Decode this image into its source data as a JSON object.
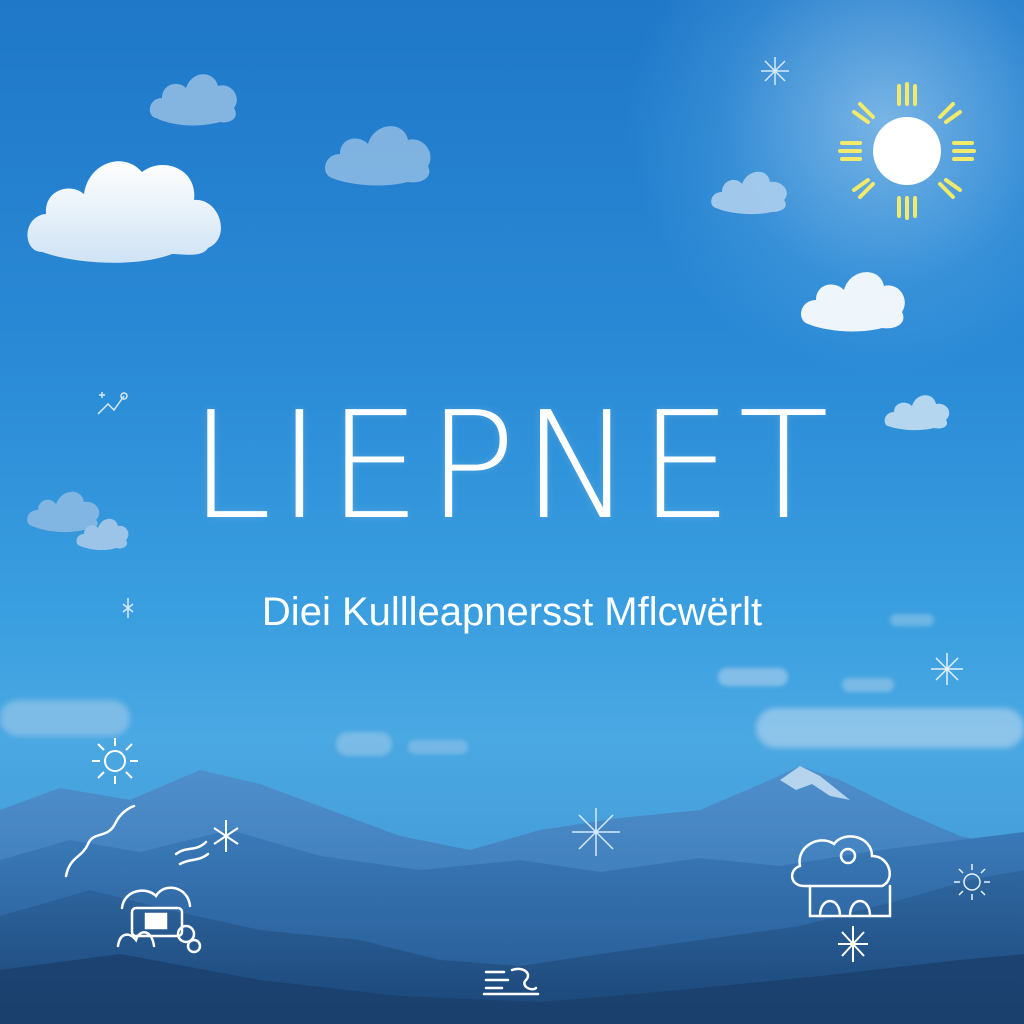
{
  "brand": {
    "title": "LIEPNET",
    "subtitle": "Diei Kullleapnersst Mflcwërlt"
  },
  "colors": {
    "sky_top": "#1f78c8",
    "sky_bottom": "#4aa8e2",
    "mountains": "#2f6fae",
    "text": "#ffffff",
    "sun": "#ffffff",
    "sun_rays": "#f2ea6a"
  },
  "icons": [
    "sun-icon",
    "cloud-icon",
    "snowflake-icon",
    "weather-doodle-icon"
  ]
}
